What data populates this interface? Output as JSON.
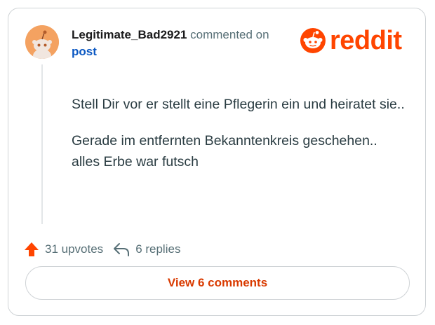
{
  "comment": {
    "username": "Legitimate_Bad2921",
    "commented_text": "commented on",
    "post_link": "post",
    "body": [
      "Stell Dir vor er stellt eine Pflegerin ein und heiratet sie..",
      "Gerade im entfernten Bekanntenkreis geschehen.. alles Erbe war futsch"
    ]
  },
  "brand": {
    "name": "reddit",
    "color": "#ff4500",
    "icon": "reddit-snoo-icon"
  },
  "actions": {
    "upvotes": "31 upvotes",
    "upvote_icon": "upvote-arrow-icon",
    "replies": "6 replies",
    "reply_icon": "reply-arrow-icon"
  },
  "view_comments": {
    "label": "View 6 comments",
    "color": "#d93a00"
  },
  "colors": {
    "link": "#0a57c2",
    "muted": "#576f76",
    "border": "#cfd3d6"
  }
}
